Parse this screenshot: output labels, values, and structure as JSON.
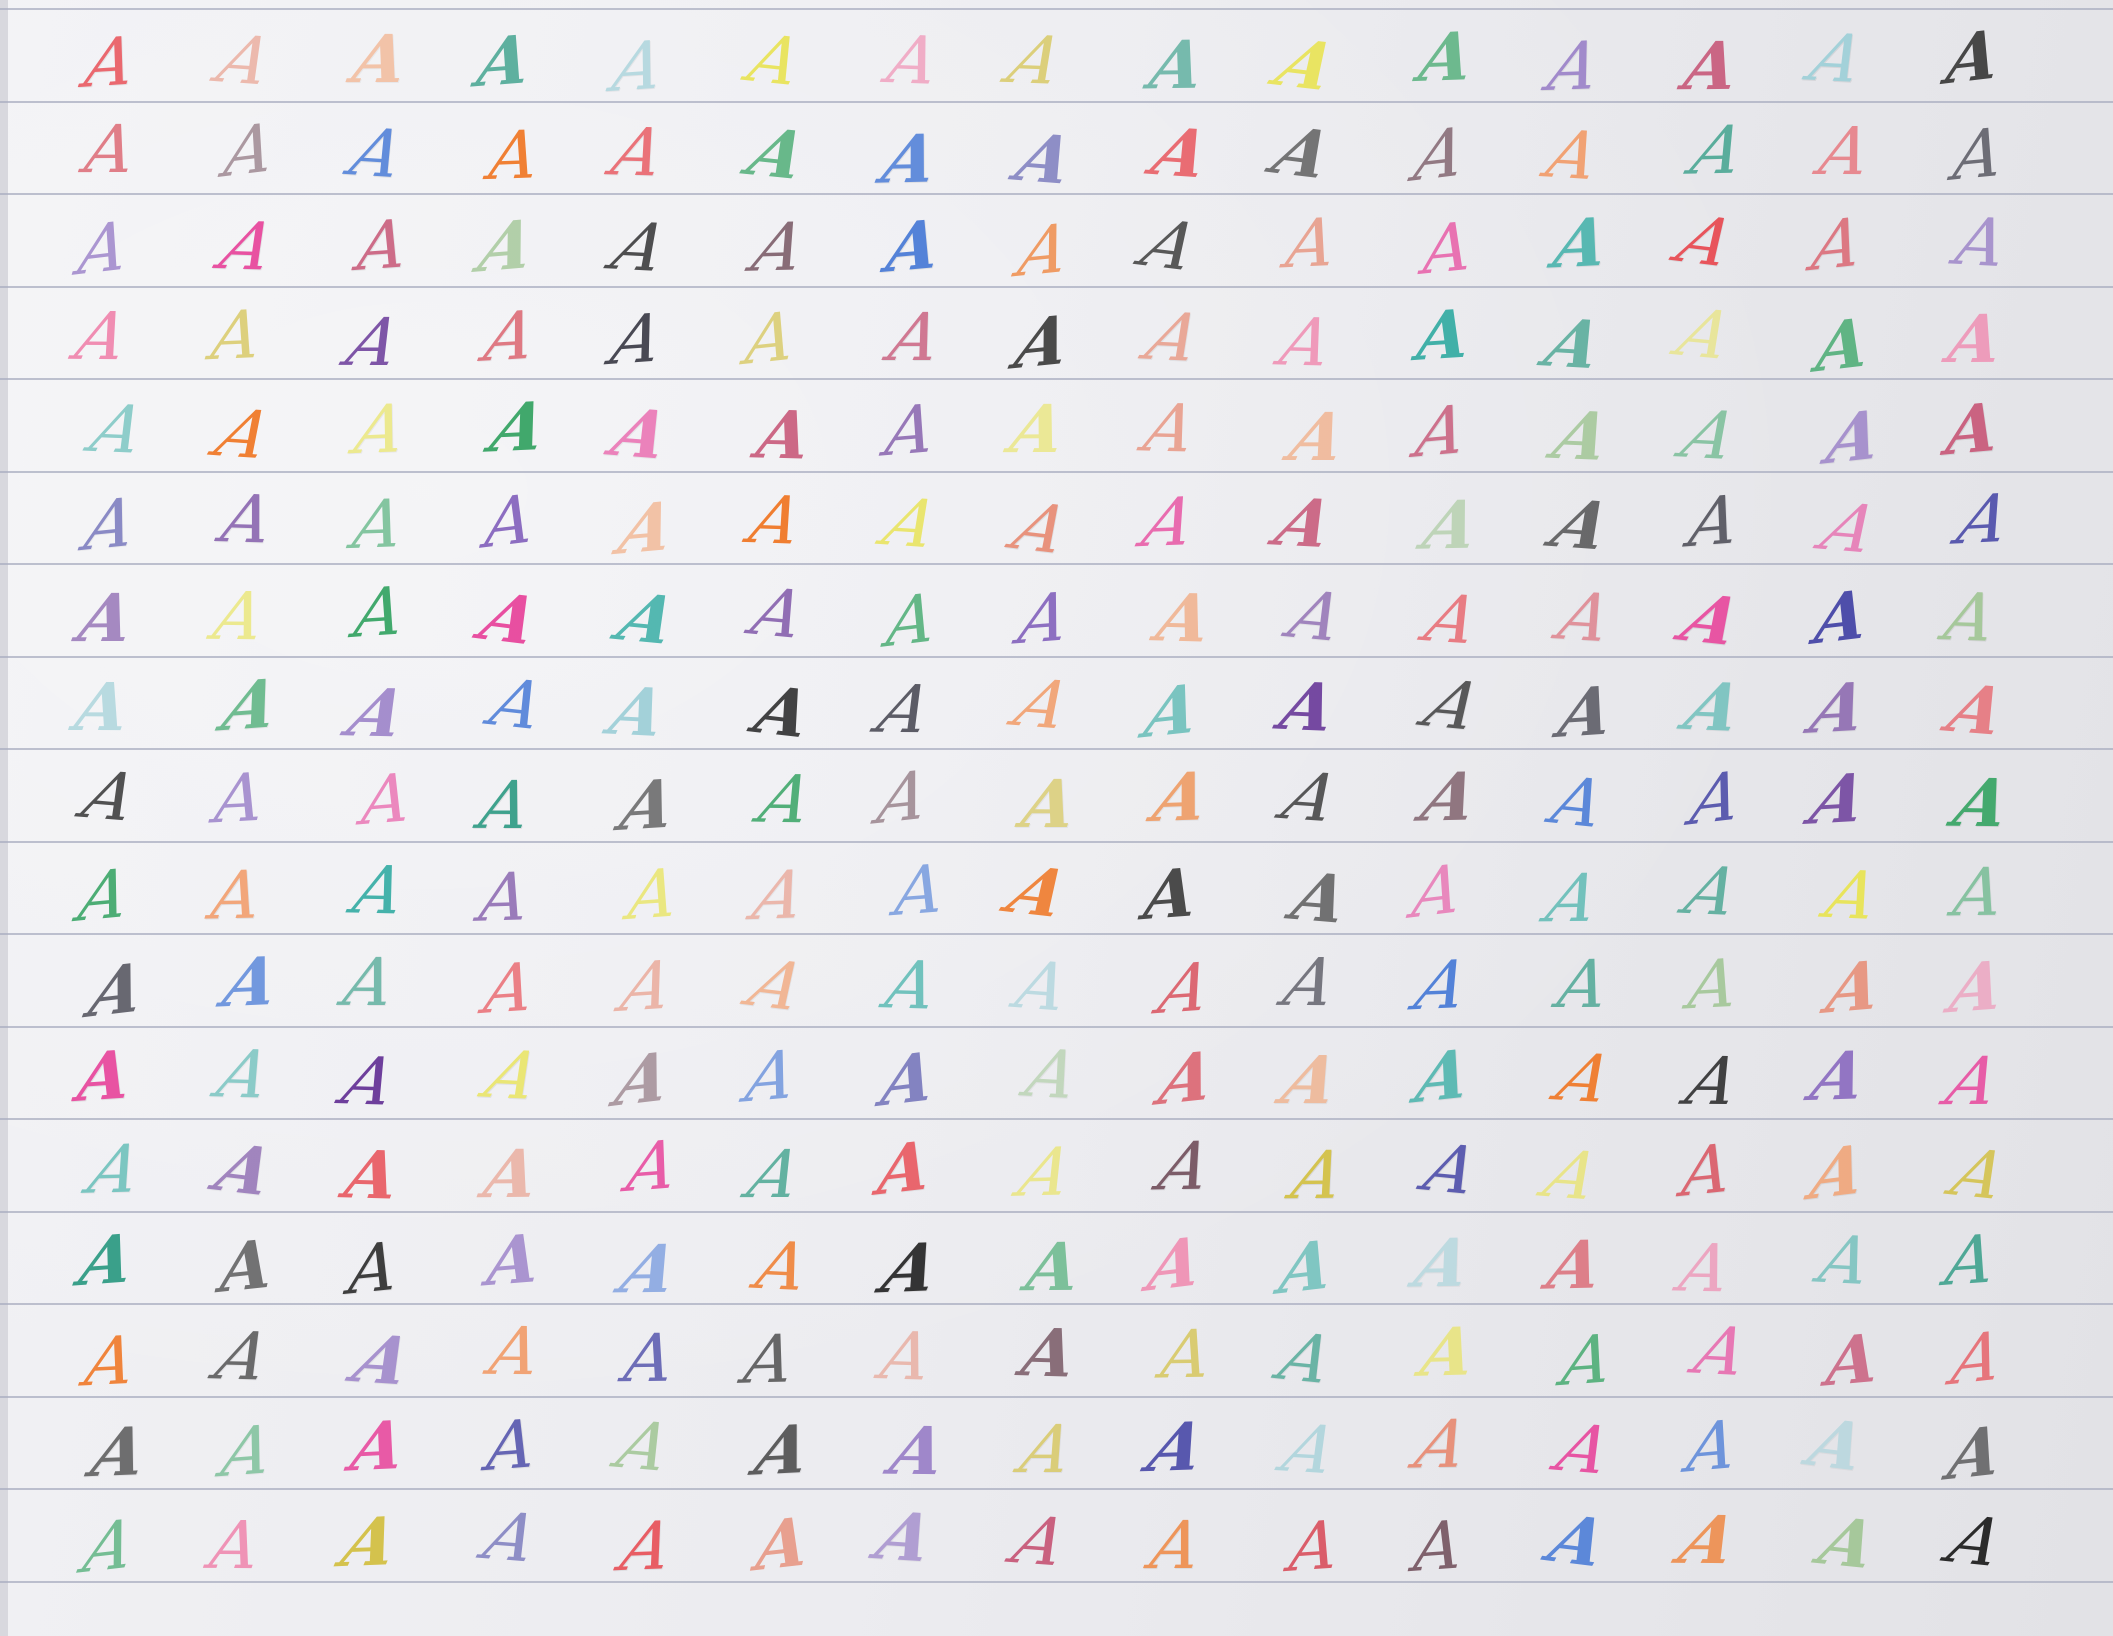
{
  "glyph": "A",
  "palette": [
    "#e8424a",
    "#3a3a3a",
    "#e9e45a",
    "#2b2b2b",
    "#d94f5c",
    "#3fa86b",
    "#e8907a",
    "#2e2e3a",
    "#7a5a66",
    "#8a6bc0",
    "#f08ab0",
    "#e84ea0",
    "#f2a070",
    "#4f7fd8",
    "#d4c24a",
    "#3fb0a8",
    "#c85a7a",
    "#4a4aa8",
    "#3aa08a",
    "#f07a2a",
    "#6a3a9a",
    "#9fd0d8",
    "#a5c89a"
  ],
  "grid": {
    "columns": 15,
    "rows": 17
  }
}
